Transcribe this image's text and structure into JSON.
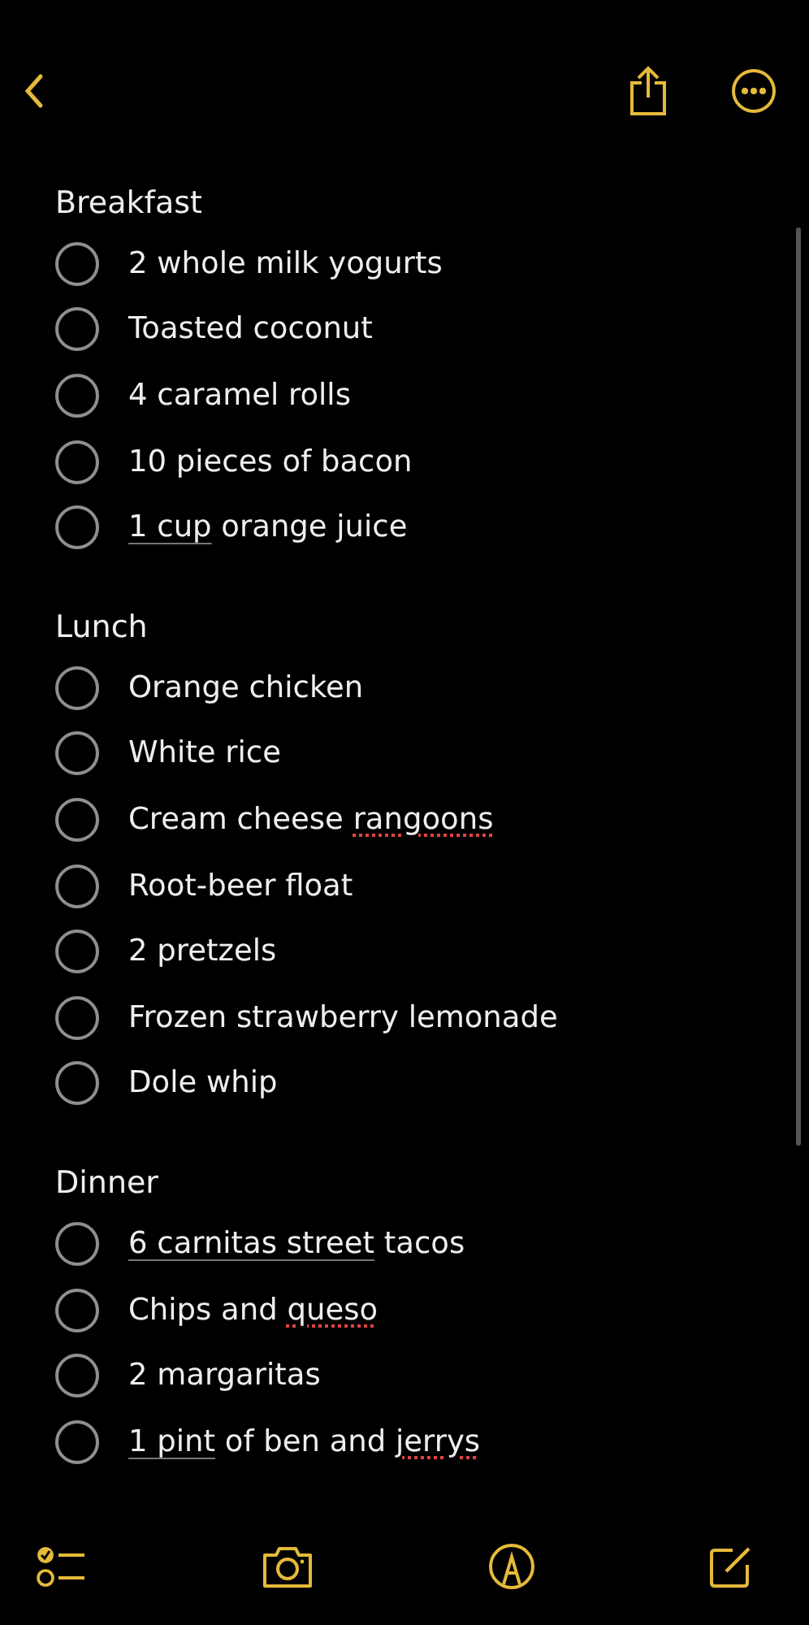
{
  "sections": [
    {
      "title": "Breakfast",
      "items": [
        {
          "checked": false,
          "parts": [
            {
              "kind": "plain",
              "text": "2 whole milk yogurts"
            }
          ]
        },
        {
          "checked": false,
          "parts": [
            {
              "kind": "plain",
              "text": "Toasted coconut"
            }
          ]
        },
        {
          "checked": false,
          "parts": [
            {
              "kind": "plain",
              "text": "4 caramel rolls"
            }
          ]
        },
        {
          "checked": false,
          "parts": [
            {
              "kind": "plain",
              "text": "10 pieces of bacon"
            }
          ]
        },
        {
          "checked": false,
          "parts": [
            {
              "kind": "detected",
              "text": "1 cup"
            },
            {
              "kind": "plain",
              "text": " orange juice"
            }
          ]
        }
      ]
    },
    {
      "title": "Lunch",
      "items": [
        {
          "checked": false,
          "parts": [
            {
              "kind": "plain",
              "text": "Orange chicken"
            }
          ]
        },
        {
          "checked": false,
          "parts": [
            {
              "kind": "plain",
              "text": "White rice"
            }
          ]
        },
        {
          "checked": false,
          "parts": [
            {
              "kind": "plain",
              "text": "Cream cheese "
            },
            {
              "kind": "misspelled",
              "text": "rangoons"
            }
          ]
        },
        {
          "checked": false,
          "parts": [
            {
              "kind": "plain",
              "text": "Root-beer float"
            }
          ]
        },
        {
          "checked": false,
          "parts": [
            {
              "kind": "plain",
              "text": "2 pretzels"
            }
          ]
        },
        {
          "checked": false,
          "parts": [
            {
              "kind": "plain",
              "text": "Frozen strawberry lemonade"
            }
          ]
        },
        {
          "checked": false,
          "parts": [
            {
              "kind": "plain",
              "text": "Dole whip"
            }
          ]
        }
      ]
    },
    {
      "title": "Dinner",
      "items": [
        {
          "checked": false,
          "parts": [
            {
              "kind": "detected",
              "text": "6 carnitas street"
            },
            {
              "kind": "plain",
              "text": " tacos"
            }
          ]
        },
        {
          "checked": false,
          "parts": [
            {
              "kind": "plain",
              "text": "Chips and "
            },
            {
              "kind": "misspelled",
              "text": "queso"
            }
          ]
        },
        {
          "checked": false,
          "parts": [
            {
              "kind": "plain",
              "text": "2 margaritas"
            }
          ]
        },
        {
          "checked": false,
          "parts": [
            {
              "kind": "detected",
              "text": "1 pint"
            },
            {
              "kind": "plain",
              "text": " of ben and "
            },
            {
              "kind": "misspelled",
              "text": "jerrys"
            }
          ]
        }
      ]
    }
  ]
}
